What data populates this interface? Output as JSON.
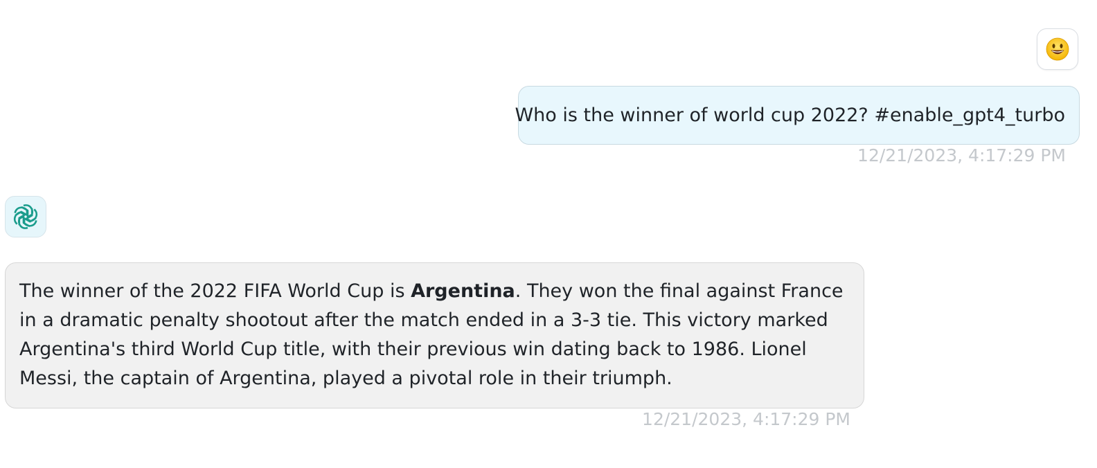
{
  "messages": [
    {
      "role": "user",
      "avatar_icon": "smiley-emoji-icon",
      "avatar_glyph": "😃",
      "text": "Who is the winner of world cup 2022? #enable_gpt4_turbo",
      "timestamp": "12/21/2023, 4:17:29 PM"
    },
    {
      "role": "assistant",
      "avatar_icon": "openai-logo-icon",
      "text_before_bold": "The winner of the 2022 FIFA World Cup is ",
      "bold_text": "Argentina",
      "text_after_bold": ". They won the final against France in a dramatic penalty shootout after the match ended in a 3-3 tie. This victory marked Argentina's third World Cup title, with their previous win dating back to 1986. Lionel Messi, the captain of Argentina, played a pivotal role in their triumph.",
      "timestamp": "12/21/2023, 4:17:29 PM"
    }
  ],
  "colors": {
    "user_bubble_bg": "#e8f7fd",
    "bot_bubble_bg": "#f1f1f1",
    "bot_avatar_bg": "#e6f6fb",
    "logo_teal": "#1a9c8c",
    "timestamp": "#c4c8cc"
  }
}
